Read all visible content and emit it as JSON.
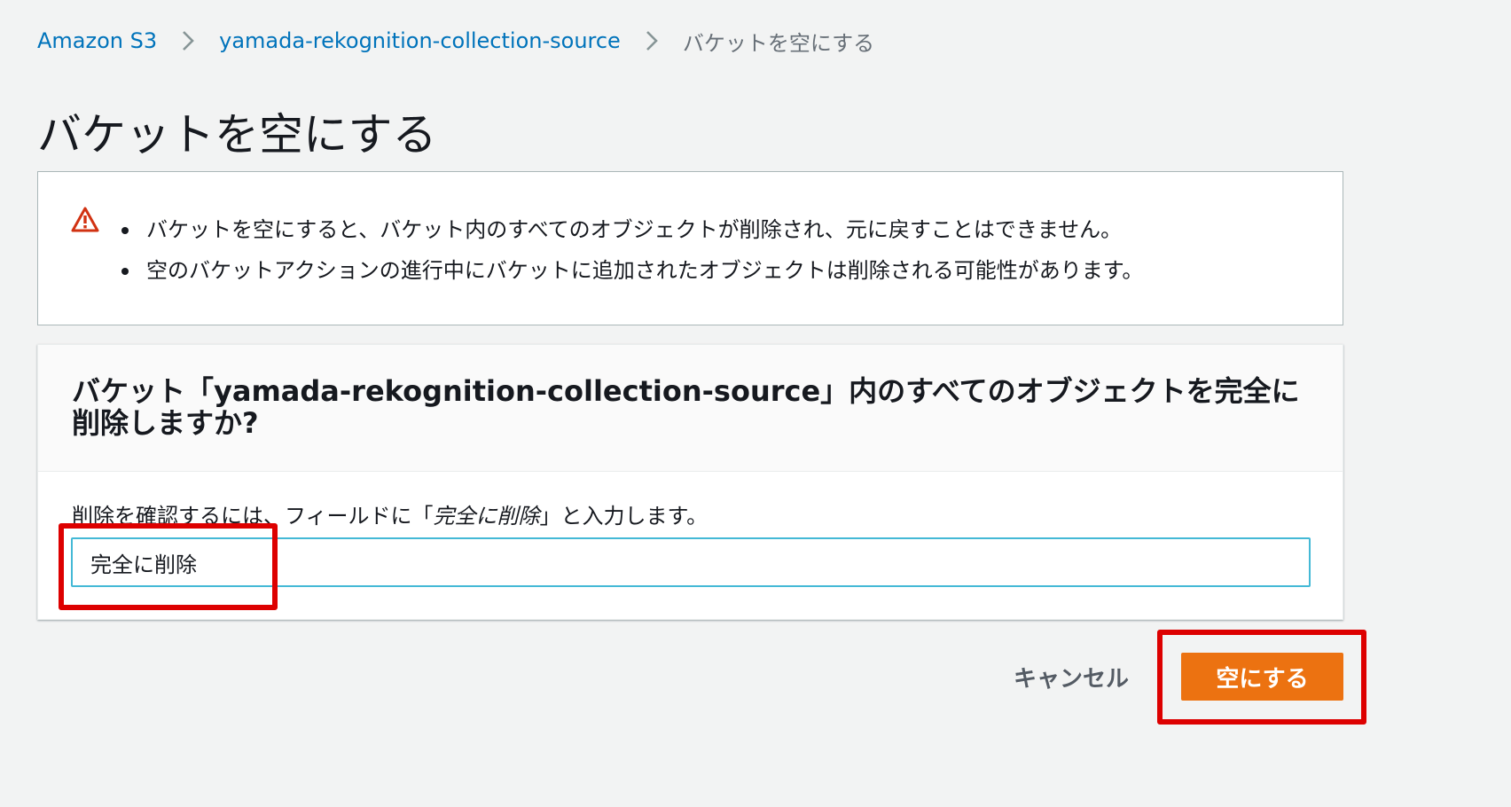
{
  "colors": {
    "link": "#0073bb",
    "warning_icon": "#d13212",
    "primary_button": "#ec7211",
    "input_focus_border": "#44b9d6",
    "highlight_annotation": "#dd0000"
  },
  "breadcrumb": {
    "items": [
      {
        "label": "Amazon S3",
        "link": true
      },
      {
        "label": "yamada-rekognition-collection-source",
        "link": true
      },
      {
        "label": "バケットを空にする",
        "link": false
      }
    ],
    "separator_icon": "chevron-right-icon"
  },
  "page": {
    "title": "バケットを空にする"
  },
  "alert": {
    "icon": "warning-triangle-icon",
    "items": [
      "バケットを空にすると、バケット内のすべてのオブジェクトが削除され、元に戻すことはできません。",
      "空のバケットアクションの進行中にバケットに追加されたオブジェクトは削除される可能性があります。"
    ]
  },
  "confirm": {
    "heading": "バケット「yamada-rekognition-collection-source」内のすべてのオブジェクトを完全に削除しますか?",
    "label_prefix": "削除を確認するには、フィールドに「",
    "label_keyword": "完全に削除",
    "label_suffix": "」と入力します。",
    "input_value": "完全に削除"
  },
  "actions": {
    "cancel_label": "キャンセル",
    "submit_label": "空にする"
  }
}
